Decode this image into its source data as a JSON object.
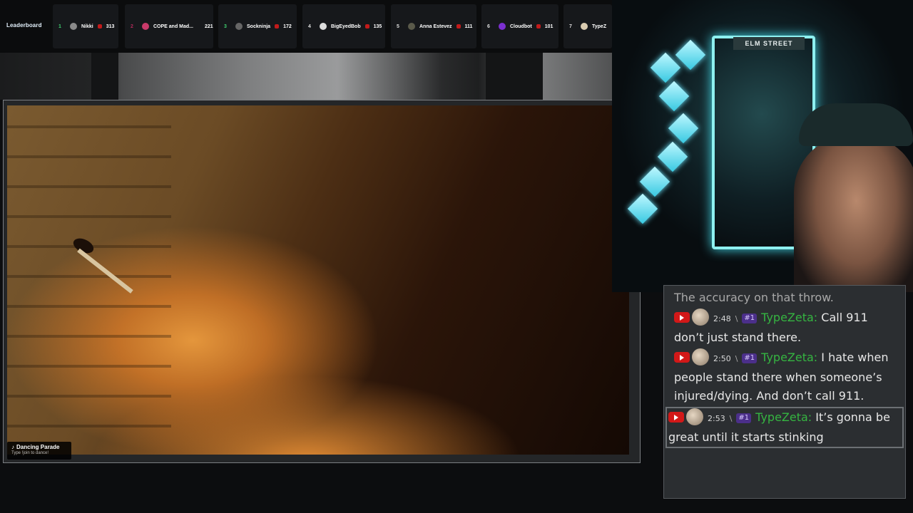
{
  "leaderboard": {
    "title": "Leaderboard",
    "entries": [
      {
        "rank": "1",
        "name": "Nikki",
        "score": "313",
        "avatar_color": "#8a8a8a"
      },
      {
        "rank": "2",
        "name": "COPE and Mad...",
        "score": "221",
        "avatar_color": "#c93a6a"
      },
      {
        "rank": "3",
        "name": "Sockninja",
        "score": "172",
        "avatar_color": "#666666"
      },
      {
        "rank": "4",
        "name": "BigEyedBob",
        "score": "135",
        "avatar_color": "#dddddd"
      },
      {
        "rank": "5",
        "name": "Anna Estevez",
        "score": "111",
        "avatar_color": "#5a5a4a"
      },
      {
        "rank": "6",
        "name": "Cloudbot",
        "score": "101",
        "avatar_color": "#7b2fd0"
      },
      {
        "rank": "7",
        "name": "TypeZ",
        "score": "",
        "avatar_color": "#d9cbb0"
      }
    ],
    "rank_color": "#3fcf6f",
    "dot_color": "#c21a1a"
  },
  "overlay": {
    "dance_title": "Dancing Parade",
    "dance_subtitle": "Type !join to dance!"
  },
  "webcam": {
    "sign_text": "ELM STREET"
  },
  "chat": {
    "partial_line": "The accuracy on that throw.",
    "messages": [
      {
        "time": "2:48",
        "separator": "\\",
        "badge": "#1",
        "user": "TypeZeta:",
        "text": "Call 911 don’t just stand there."
      },
      {
        "time": "2:50",
        "separator": "\\",
        "badge": "#1",
        "user": "TypeZeta:",
        "text": "I hate when people stand there when someone’s injured/dying. And don’t call 911."
      },
      {
        "time": "2:53",
        "separator": "\\",
        "badge": "#1",
        "user": "TypeZeta:",
        "text": "It’s gonna be great until it starts stinking"
      }
    ],
    "user_color": "#35b541",
    "youtube_color": "#d21818"
  }
}
